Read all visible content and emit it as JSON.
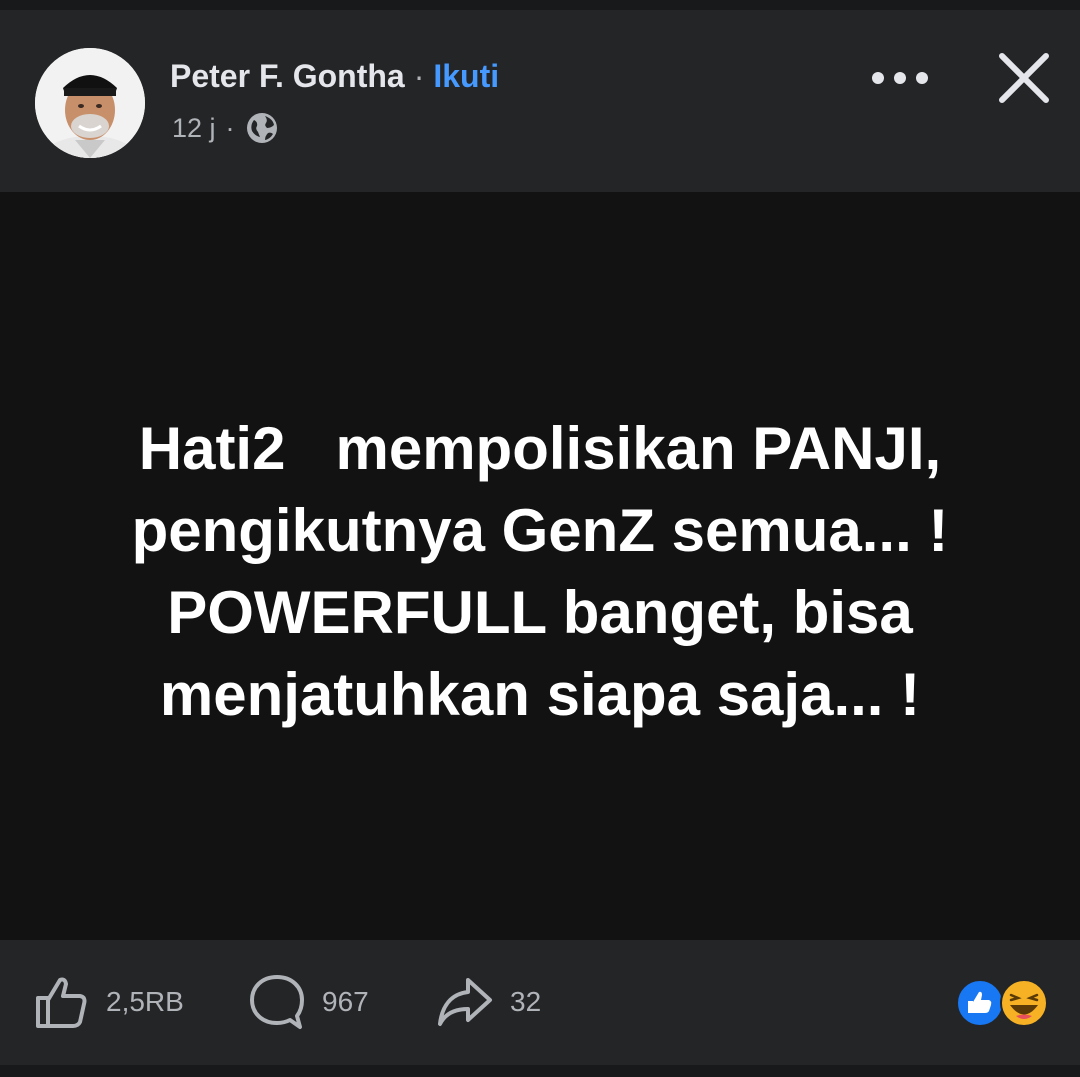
{
  "post": {
    "author": "Peter F. Gontha",
    "separator": "·",
    "follow_label": "Ikuti",
    "time": "12 j",
    "time_separator": "·",
    "audience_icon": "globe-icon",
    "text": "Hati2   mempolisikan PANJI,\npengikutnya GenZ semua... !\nPOWERFULL banget, bisa\nmenjatuhkan siapa saja... !"
  },
  "actions": {
    "like_count": "2,5RB",
    "comment_count": "967",
    "share_count": "32"
  },
  "reactions": [
    "like",
    "haha"
  ],
  "colors": {
    "surface": "#242526",
    "post_background": "#121212",
    "link": "#4599ff",
    "secondary_text": "#b0b3b8",
    "like_blue": "#1877f2",
    "haha_yellow": "#f7b125"
  }
}
